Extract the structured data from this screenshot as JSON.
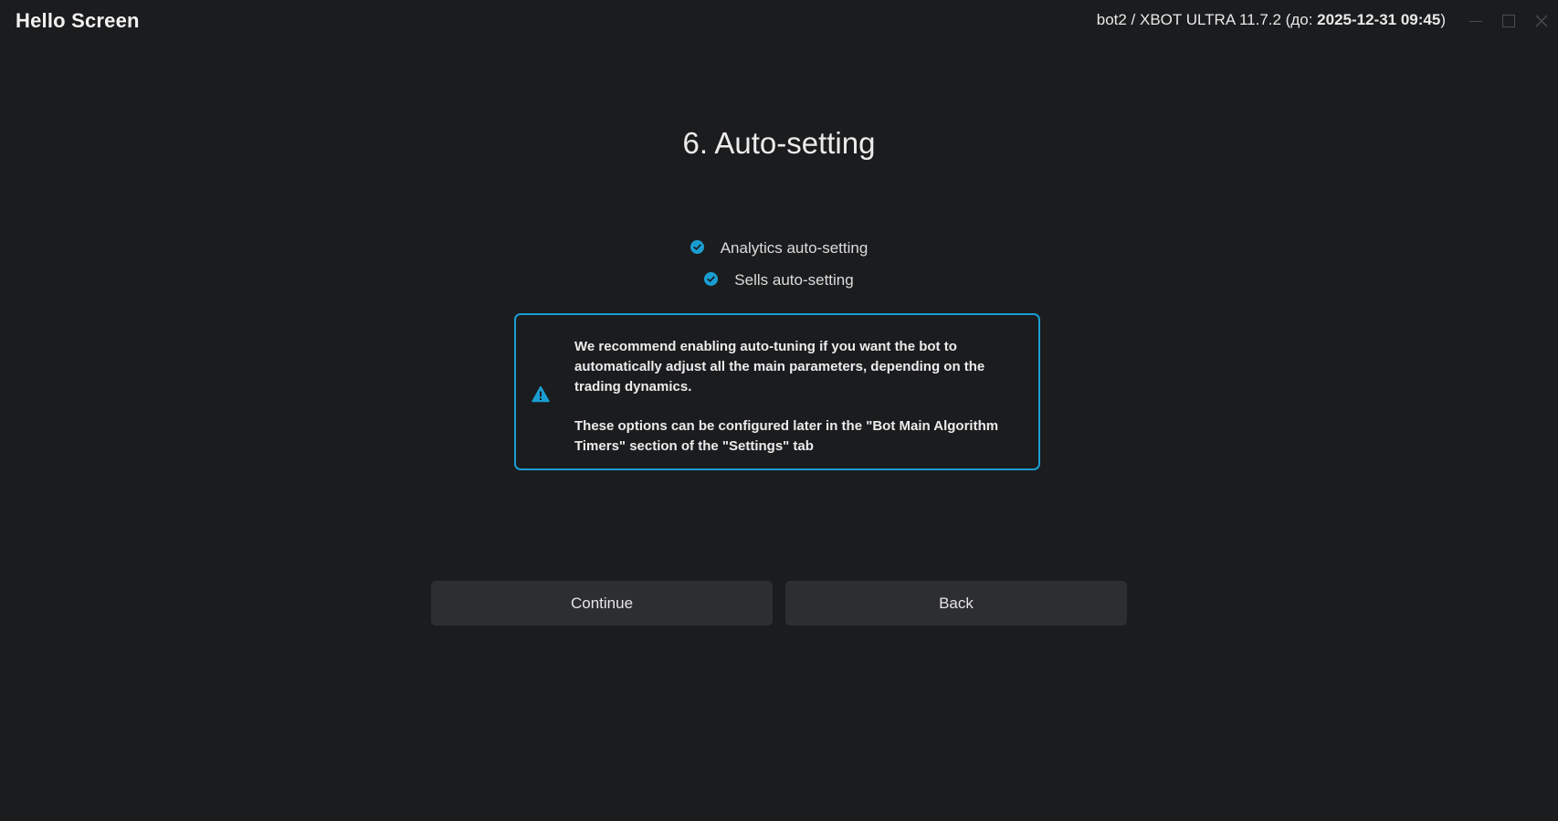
{
  "window": {
    "title": "Hello Screen",
    "bot_info_prefix": "bot2 / XBOT ULTRA 11.7.2 (до: ",
    "bot_info_date": "2025-12-31 09:45",
    "bot_info_suffix": ")"
  },
  "main": {
    "heading": "6. Auto-setting",
    "checklist": [
      {
        "label": "Analytics auto-setting",
        "checked": true
      },
      {
        "label": "Sells auto-setting",
        "checked": true
      }
    ],
    "notice": {
      "paragraph1": "We recommend enabling auto-tuning if you want the bot to automatically adjust all the main parameters, depending on the trading dynamics.",
      "paragraph2": "These options can be configured later in the \"Bot Main Algorithm Timers\" section of the \"Settings\" tab",
      "icon": "warning-icon"
    },
    "buttons": {
      "continue_label": "Continue",
      "back_label": "Back"
    }
  },
  "colors": {
    "background": "#1b1c1e",
    "accent": "#1a9ed2",
    "button_bg": "#2d2e31"
  }
}
